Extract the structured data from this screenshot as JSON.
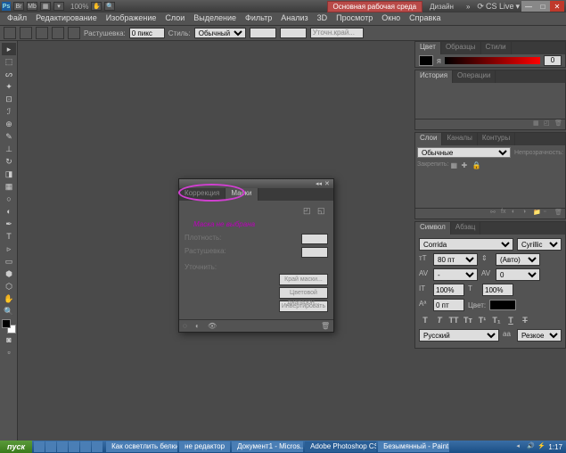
{
  "titlebar": {
    "zoom": "100%",
    "workspace1": "Основная рабочая среда",
    "workspace2": "Дизайн",
    "cslive": "CS Live"
  },
  "menu": [
    "Файл",
    "Редактирование",
    "Изображение",
    "Слои",
    "Выделение",
    "Фильтр",
    "Анализ",
    "3D",
    "Просмотр",
    "Окно",
    "Справка"
  ],
  "options": {
    "label1": "Растушевка:",
    "feather": "0 пикс",
    "label2": "Стиль:",
    "style": "Обычный",
    "search": "Уточн.край..."
  },
  "panels": {
    "color": {
      "tabs": [
        "Цвет",
        "Образцы",
        "Стили"
      ],
      "value": "0"
    },
    "history": {
      "tabs": [
        "История",
        "Операции"
      ]
    },
    "layers": {
      "tabs": [
        "Слои",
        "Каналы",
        "Контуры"
      ],
      "mode": "Обычные",
      "opacity_lbl": "Непрозрачность:"
    },
    "character": {
      "tabs": [
        "Символ",
        "Абзац"
      ],
      "font": "Corrida",
      "script": "Cyrillic",
      "size": "80 пт",
      "leading": "(Авто)",
      "tracking": "0",
      "vscale": "100%",
      "hscale": "100%",
      "baseline": "0 пт",
      "color_lbl": "Цвет:",
      "lang": "Русский",
      "aa": "Резкое"
    }
  },
  "dialog": {
    "tabs": [
      "Коррекция",
      "Маски"
    ],
    "msg": "Маска не выбрана",
    "row1": "Плотность:",
    "row2": "Растушевка:",
    "row3": "Уточнить:",
    "btn1": "Край маски...",
    "btn2": "Цветовой диапазон...",
    "btn3": "Инвертировать"
  },
  "taskbar": {
    "start": "пуск",
    "items": [
      "Как осветлить белки",
      "не редактор",
      "Документ1 - Micros...",
      "Adobe Photoshop CS...",
      "Безымянный - Paint"
    ],
    "time": "1:17"
  }
}
